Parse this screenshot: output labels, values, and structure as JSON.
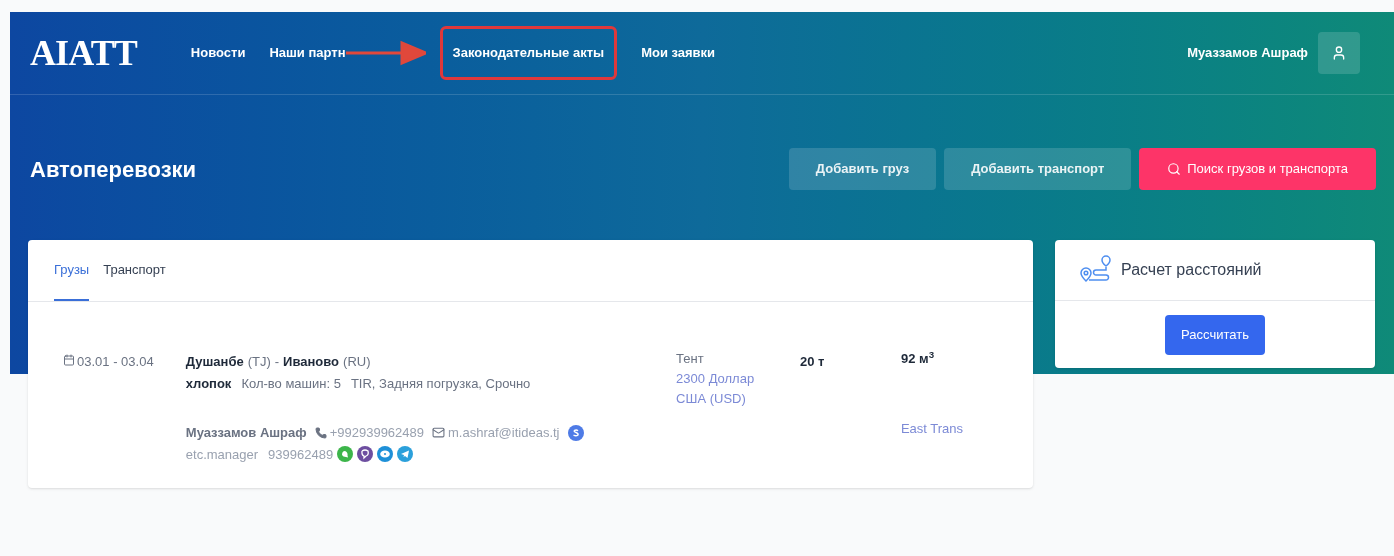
{
  "logo": "AIATT",
  "nav": [
    {
      "label": "Новости",
      "selected": false
    },
    {
      "label": "Наши партн",
      "selected": false
    },
    {
      "label": "Законодательные акты",
      "selected": true
    },
    {
      "label": "Мои заявки",
      "selected": false
    }
  ],
  "user": {
    "name": "Муаззамов Ашраф"
  },
  "page_title": "Автоперевозки",
  "actions": [
    {
      "label": "Добавить груз",
      "kind": "secondary"
    },
    {
      "label": "Добавить транспорт",
      "kind": "secondary"
    },
    {
      "label": "Поиск грузов и транспорта",
      "kind": "primary"
    }
  ],
  "tabs": [
    {
      "label": "Грузы",
      "selected": true
    },
    {
      "label": "Транспорт",
      "selected": false
    }
  ],
  "listing": {
    "dates": "03.01 - 03.04",
    "from_city": "Душанбе",
    "from_country": "(TJ)",
    "separator": "-",
    "to_city": "Иваново",
    "to_country": "(RU)",
    "cargo": "хлопок",
    "trucks": "Кол-во машин: 5",
    "options": "TIR, Задняя погрузка, Срочно",
    "body": "Тент",
    "price": "2300 Доллар США (USD)",
    "weight": "20 т",
    "volume": "92 м$^{3}$",
    "contact_name": "Муаззамов Ашраф",
    "phone": "+992939962489",
    "email": "m.ashraf@itideas.tj",
    "login": "etc.manager",
    "messenger_phone": "939962489",
    "company": "East Trans"
  },
  "distance_card": {
    "title": "Расчет расстояний",
    "button": "Рассчитать"
  }
}
